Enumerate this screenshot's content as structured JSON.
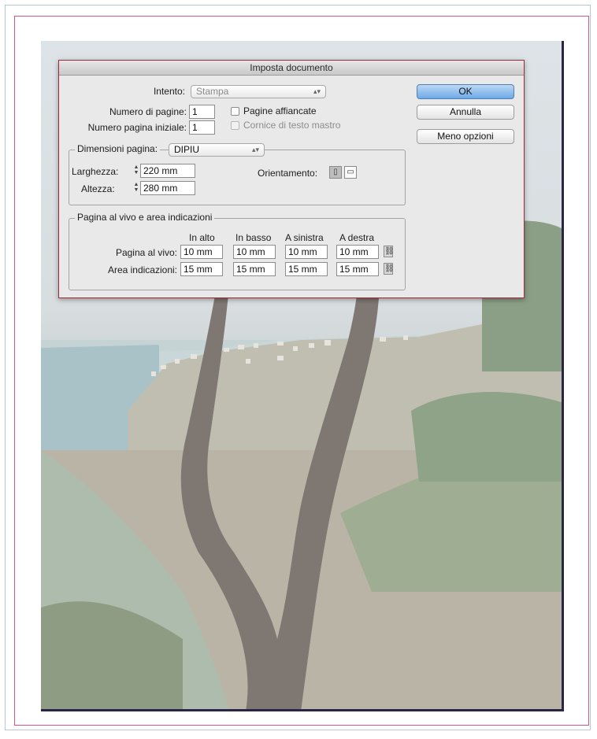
{
  "dialog": {
    "title": "Imposta documento",
    "intent_label": "Intento:",
    "intent_value": "Stampa",
    "num_pages_label": "Numero di pagine:",
    "num_pages_value": "1",
    "start_page_label": "Numero pagina iniziale:",
    "start_page_value": "1",
    "facing_pages_label": "Pagine affiancate",
    "master_text_frame_label": "Cornice di testo mastro",
    "page_size_label": "Dimensioni pagina:",
    "page_size_value": "DIPIU",
    "width_label": "Larghezza:",
    "width_value": "220 mm",
    "height_label": "Altezza:",
    "height_value": "280 mm",
    "orientation_label": "Orientamento:",
    "bleed_group_label": "Pagina al vivo e area indicazioni",
    "columns": [
      "In alto",
      "In basso",
      "A sinistra",
      "A destra"
    ],
    "bleed_row_label": "Pagina al vivo:",
    "bleed_values": [
      "10 mm",
      "10 mm",
      "10 mm",
      "10 mm"
    ],
    "slug_row_label": "Area indicazioni:",
    "slug_values": [
      "15 mm",
      "15 mm",
      "15 mm",
      "15 mm"
    ],
    "buttons": {
      "ok": "OK",
      "cancel": "Annulla",
      "fewer_options": "Meno opzioni"
    }
  },
  "colors": {
    "accent": "#6ea9e6",
    "margin_guide": "#d5577f",
    "dialog_border": "#9c2c3a"
  }
}
